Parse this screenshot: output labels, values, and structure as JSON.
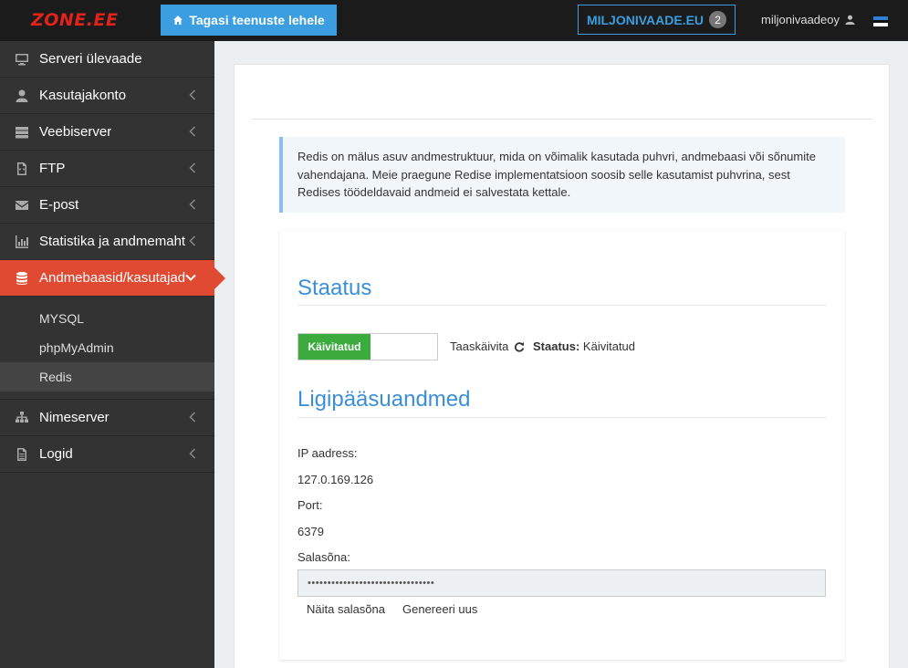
{
  "topbar": {
    "logo": "ZONE.EE",
    "back_label": "Tagasi teenuste lehele",
    "domain": "MILJONIVAADE.EU",
    "domain_count": "2",
    "username": "miljonivaadeoy"
  },
  "sidebar": {
    "items": [
      {
        "label": "Serveri ülevaade"
      },
      {
        "label": "Kasutajakonto"
      },
      {
        "label": "Veebiserver"
      },
      {
        "label": "FTP"
      },
      {
        "label": "E-post"
      },
      {
        "label": "Statistika ja andmemaht"
      },
      {
        "label": "Andmebaasid/kasutajad"
      },
      {
        "label": "Nimeserver"
      },
      {
        "label": "Logid"
      }
    ],
    "subitems": [
      {
        "label": "MYSQL"
      },
      {
        "label": "phpMyAdmin"
      },
      {
        "label": "Redis"
      }
    ]
  },
  "info": "Redis on mälus asuv andmestruktuur, mida on võimalik kasutada puhvri, andmebaasi või sõnumite vahendajana. Meie praegune Redise implementatsioon soosib selle kasutamist puhvrina, sest Redises töödeldavaid andmeid ei salvestata kettale.",
  "status_section": {
    "title": "Staatus",
    "toggle_label": "Käivitatud",
    "restart_label": "Taaskäivita",
    "status_key": "Staatus:",
    "status_value": "Käivitatud"
  },
  "access_section": {
    "title": "Ligipääsuandmed",
    "ip_label": "IP aadress:",
    "ip_value": "127.0.169.126",
    "port_label": "Port:",
    "port_value": "6379",
    "password_label": "Salasõna:",
    "password_value": "••••••••••••••••••••••••••••••••",
    "show_password": "Näita salasõna",
    "generate": "Genereeri uus"
  },
  "colors": {
    "accent": "#3a9ee0",
    "active_nav": "#e04a33",
    "toggle_on": "#3bab3e",
    "logo": "#e2231a"
  }
}
